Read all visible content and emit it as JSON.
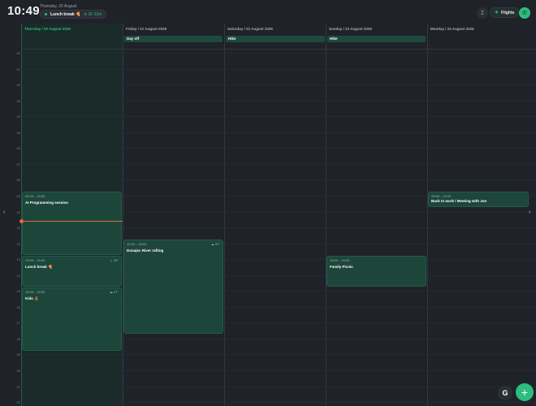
{
  "header": {
    "clock": "10:49",
    "date": "Thursday, 20 August",
    "now_event": {
      "label": "Lunch break 🍕",
      "countdown": "in 2h 10m"
    },
    "cursor_icon": "text-cursor-icon",
    "flights_label": "Flights",
    "flights_icon": "plane-off-icon",
    "phone_icon": "phone-icon"
  },
  "hours": [
    "00",
    "01",
    "02",
    "03",
    "04",
    "05",
    "06",
    "07",
    "08",
    "09",
    "10",
    "11",
    "12",
    "13",
    "14",
    "15",
    "16",
    "17",
    "18",
    "19",
    "20",
    "21",
    "22"
  ],
  "days": [
    {
      "label": "Thursday / 20 August 2026",
      "today": true
    },
    {
      "label": "Friday / 21 August 2026"
    },
    {
      "label": "Saturday / 22 August 2026"
    },
    {
      "label": "Sunday / 23 August 2026"
    },
    {
      "label": "Monday / 24 August 2026"
    }
  ],
  "allday_events": [
    {
      "title": "Day off"
    },
    {
      "title": "Hike"
    },
    {
      "title": "Hike"
    }
  ],
  "events": [
    {
      "time": "09:00 – 13:00",
      "title": "AI Programming session",
      "weather": ""
    },
    {
      "time": "13:00 – 15:00",
      "title": "Lunch break 🍕",
      "weather": "☼ 29°"
    },
    {
      "time": "15:00 – 19:00",
      "title": "Kids 🧸",
      "weather": "☁ 27°"
    },
    {
      "time": "12:00 – 18:00",
      "title": "Dunajec River rafting",
      "weather": "☁ 22°"
    },
    {
      "time": "13:00 – 15:00",
      "title": "Family Picnic",
      "weather": ""
    },
    {
      "time": "09:00 – 10:00",
      "title": "Back to work / Meeting with Jon",
      "weather": ""
    }
  ],
  "nav": {
    "prev": "‹",
    "next": "›"
  },
  "fab": {
    "google_label": "G",
    "add_label": "+"
  },
  "colors": {
    "accent": "#2dbd7e",
    "now_line": "#e5673a",
    "event_bg": "#1d463b"
  }
}
